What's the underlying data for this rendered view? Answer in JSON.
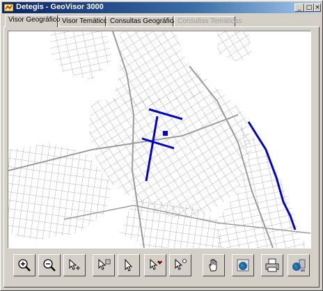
{
  "window": {
    "title": "Detegis - GeoVisor 3000",
    "controls": {
      "minimize": "_",
      "maximize": "□",
      "close": "×"
    }
  },
  "tabs": [
    {
      "label": "Visor Geográfico",
      "active": true,
      "enabled": true
    },
    {
      "label": "Visor Temático",
      "active": false,
      "enabled": true
    },
    {
      "label": "Consultas Geográficas",
      "active": false,
      "enabled": true
    },
    {
      "label": "Consultas Temáticas",
      "active": false,
      "enabled": false
    }
  ],
  "map": {
    "background": "#ffffff",
    "street_color": "#9a9a9a",
    "highlight_color": "#0000cc"
  },
  "toolbar": [
    {
      "id": "zoom-in",
      "icon": "zoom-in-icon"
    },
    {
      "id": "zoom-out",
      "icon": "zoom-out-icon"
    },
    {
      "id": "select",
      "icon": "select-arrow-icon"
    },
    {
      "id": "select-info",
      "icon": "select-info-icon"
    },
    {
      "id": "pointer",
      "icon": "pointer-icon"
    },
    {
      "id": "select-add",
      "icon": "select-add-icon"
    },
    {
      "id": "select-point",
      "icon": "select-point-icon"
    },
    {
      "id": "pan",
      "icon": "hand-pan-icon"
    },
    {
      "id": "globe-view",
      "icon": "globe-icon"
    },
    {
      "id": "print",
      "icon": "printer-icon"
    },
    {
      "id": "network",
      "icon": "network-globe-icon"
    }
  ]
}
